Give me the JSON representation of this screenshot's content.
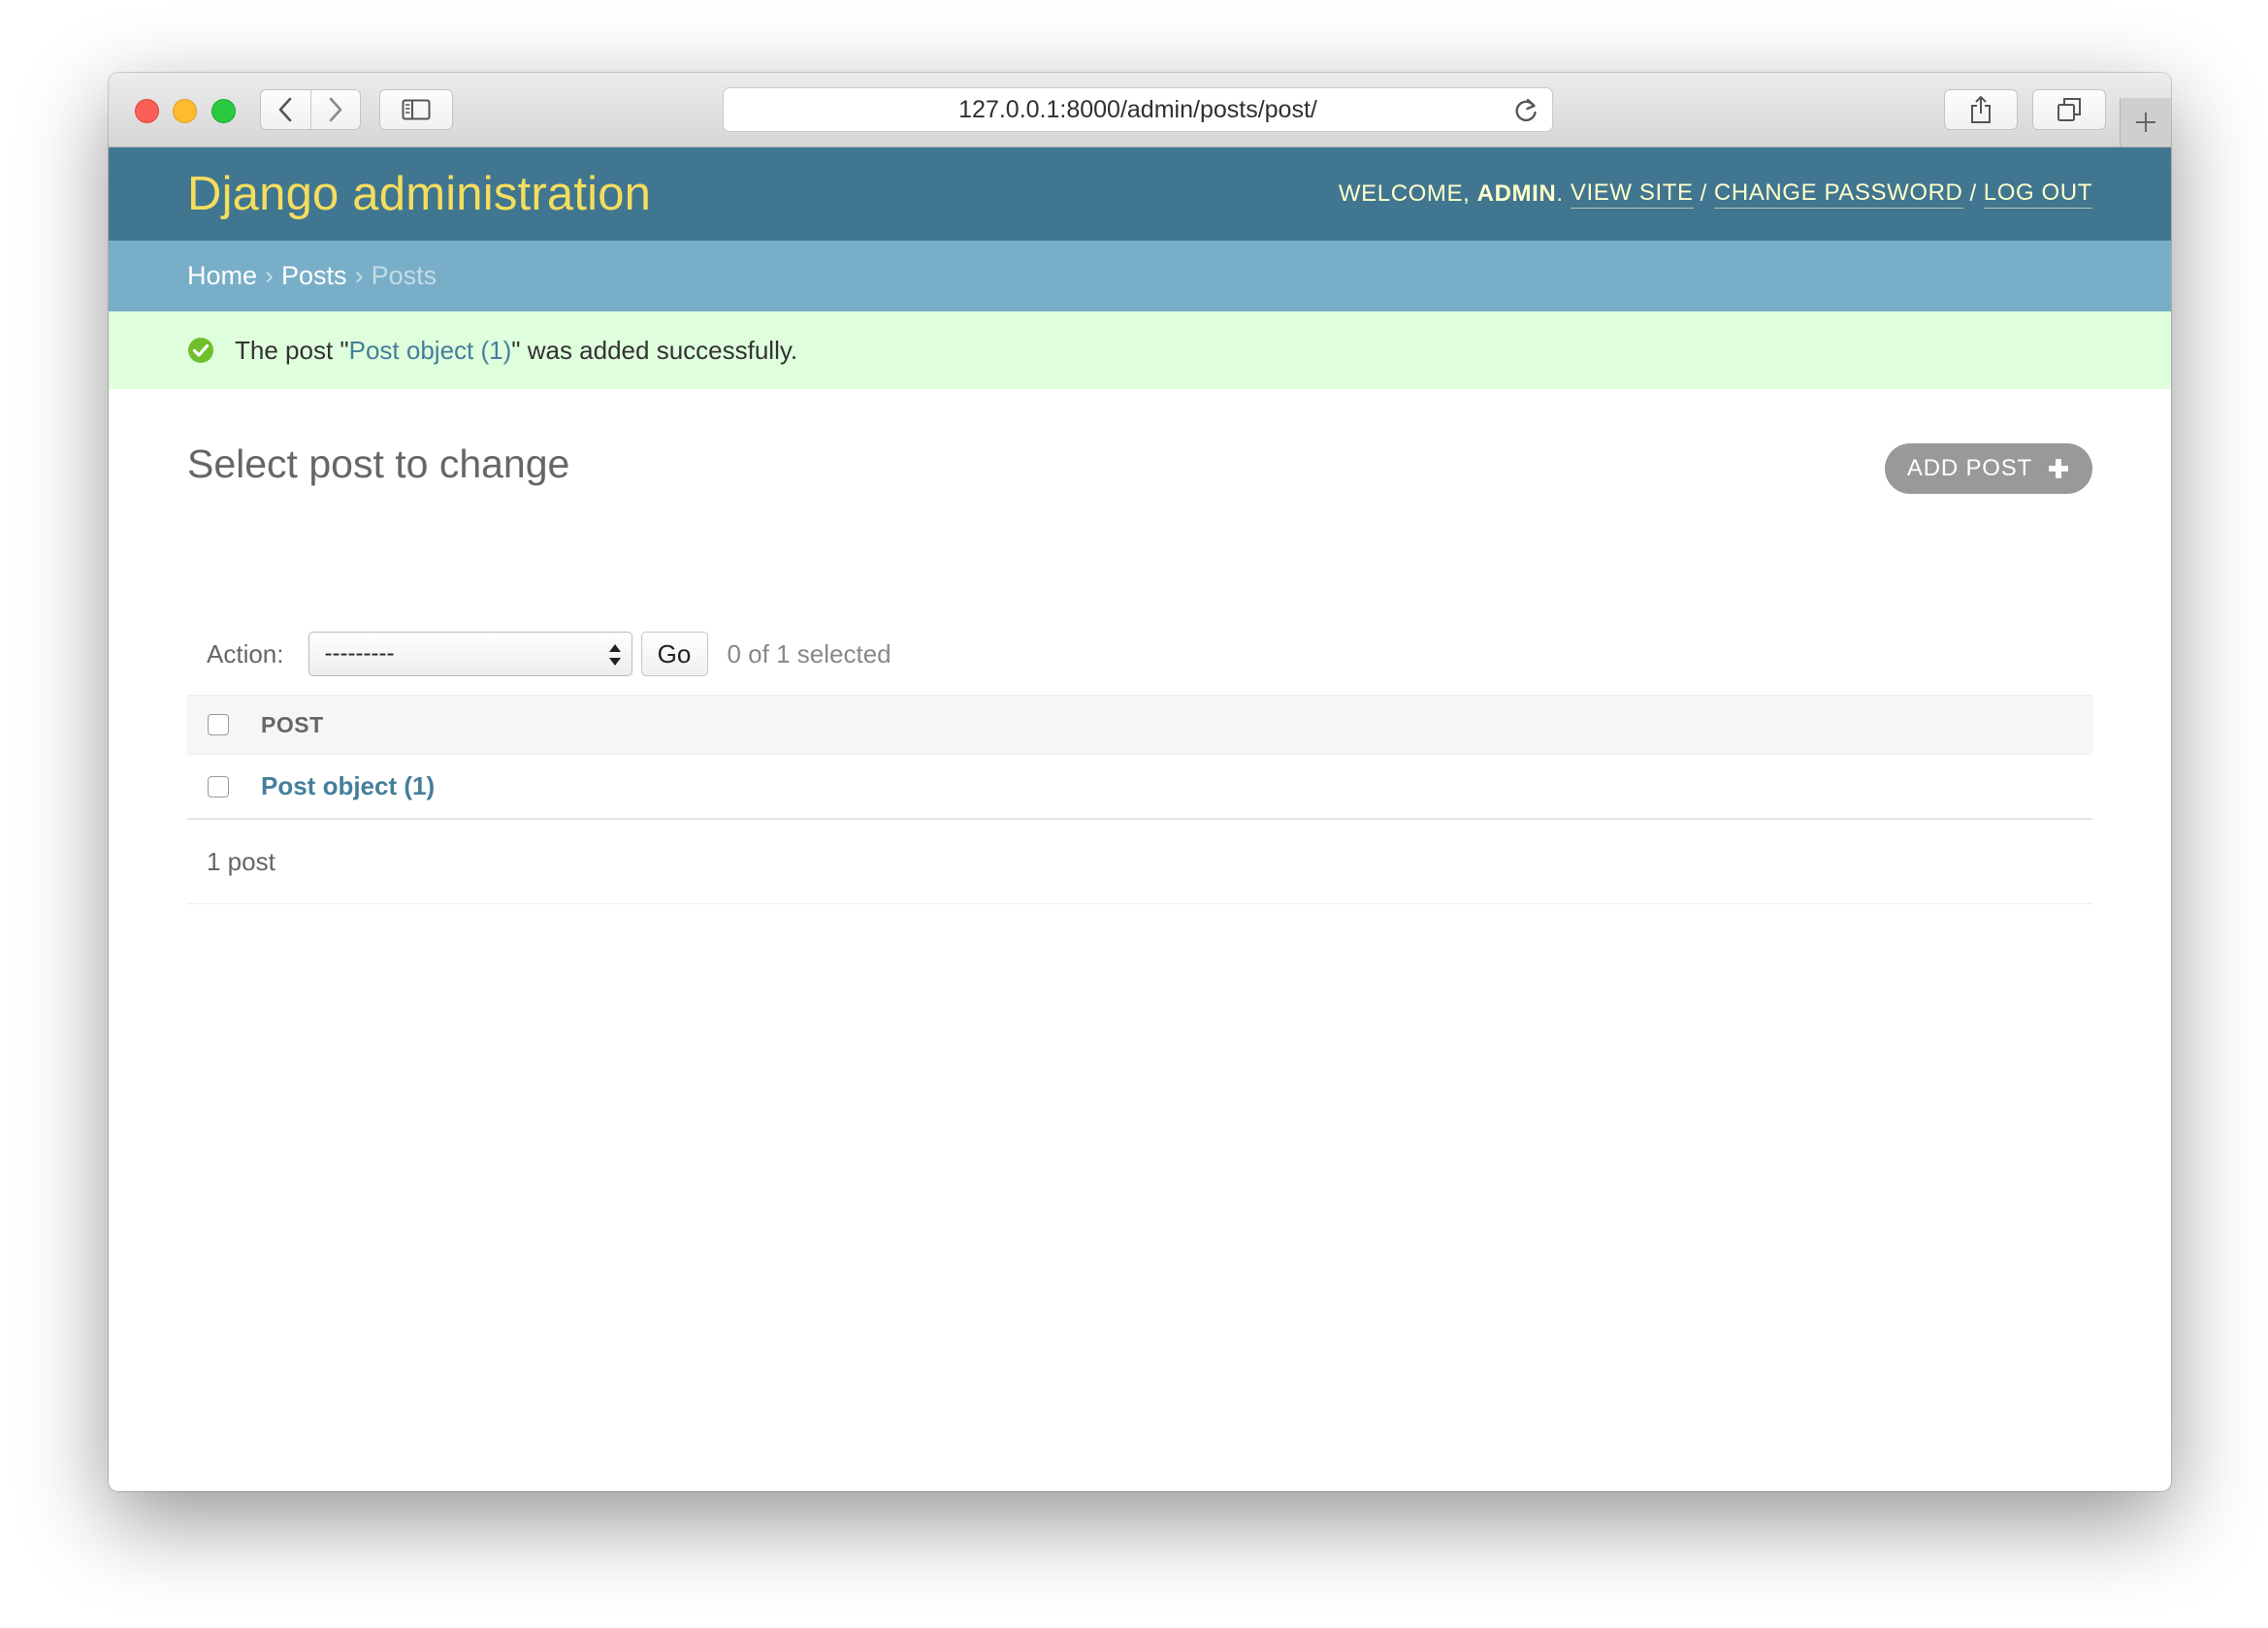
{
  "browser": {
    "url": "127.0.0.1:8000/admin/posts/post/"
  },
  "header": {
    "branding": "Django administration",
    "welcome_prefix": "WELCOME,",
    "username": "ADMIN",
    "username_suffix": ".",
    "view_site": "VIEW SITE",
    "change_password": "CHANGE PASSWORD",
    "log_out": "LOG OUT",
    "separator": "/"
  },
  "breadcrumbs": {
    "home": "Home",
    "app": "Posts",
    "current": "Posts",
    "arrow": "›"
  },
  "message": {
    "prefix": "The post \"",
    "link": "Post object (1)",
    "suffix": "\" was added successfully."
  },
  "content": {
    "title": "Select post to change",
    "add_button": "ADD POST",
    "action_label": "Action:",
    "action_selected": "---------",
    "go_button": "Go",
    "selection_counter": "0 of 1 selected",
    "table": {
      "column_header": "POST",
      "rows": [
        {
          "label": "Post object (1)"
        }
      ]
    },
    "paginator": "1 post"
  },
  "colors": {
    "header_bg": "#417690",
    "branding": "#f5dd5d",
    "breadcrumbs_bg": "#79aec8",
    "success_bg": "#dfffdc",
    "success_icon": "#70bf2b",
    "link": "#447e9b"
  },
  "icons": {
    "back": "chevron-left-icon",
    "forward": "chevron-right-icon",
    "sidebar": "sidebar-icon",
    "reload": "reload-icon",
    "share": "share-icon",
    "tabs": "tabs-icon",
    "new_tab": "plus-icon",
    "success": "checkmark-circle-icon",
    "add": "plus-icon"
  }
}
